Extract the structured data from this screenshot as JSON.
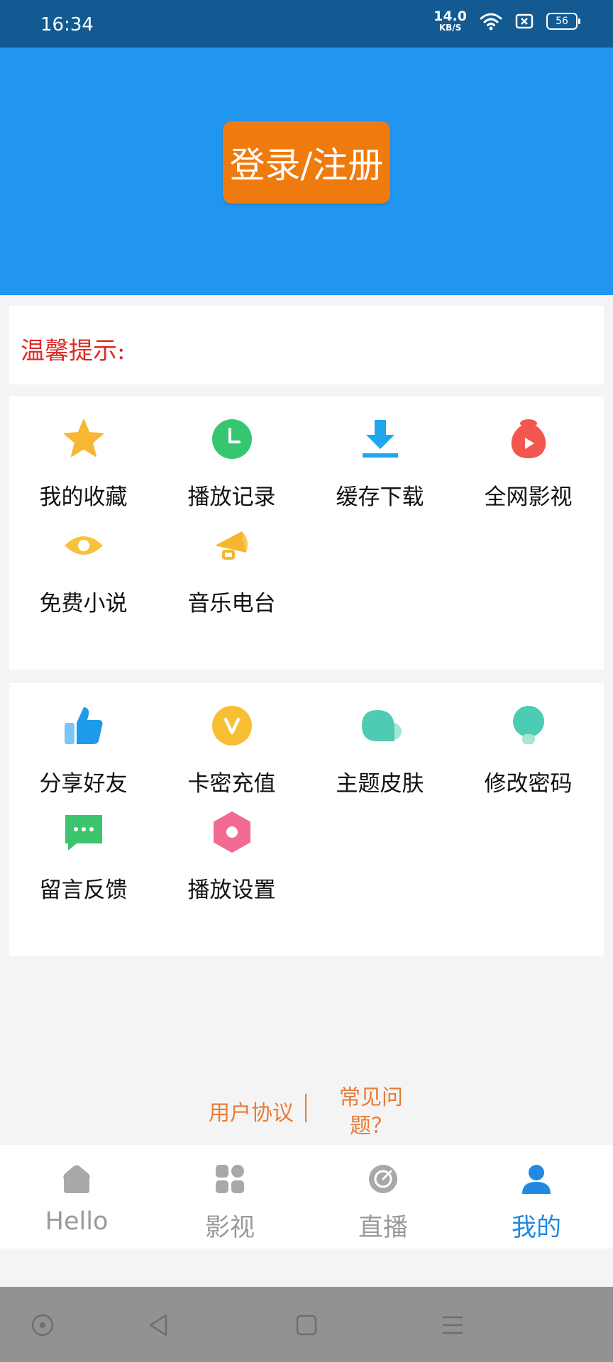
{
  "status_bar": {
    "time": "16:34",
    "net_speed_value": "14.0",
    "net_speed_unit": "KB/S",
    "battery": "56",
    "icons": [
      "wifi-icon",
      "sim-icon",
      "battery-icon"
    ]
  },
  "header": {
    "login_label": "登录/注册",
    "background": "#2196f0",
    "button_color": "#ef7a0d"
  },
  "tip": {
    "label": "温馨提示:"
  },
  "grid1": {
    "items": [
      {
        "label": "我的收藏",
        "icon": "star-icon"
      },
      {
        "label": "播放记录",
        "icon": "clock-icon"
      },
      {
        "label": "缓存下载",
        "icon": "download-icon"
      },
      {
        "label": "全网影视",
        "icon": "video-bag-icon"
      },
      {
        "label": "免费小说",
        "icon": "eye-icon"
      },
      {
        "label": "音乐电台",
        "icon": "megaphone-icon"
      }
    ]
  },
  "grid2": {
    "items": [
      {
        "label": "分享好友",
        "icon": "thumbs-up-icon"
      },
      {
        "label": "卡密充值",
        "icon": "vip-icon"
      },
      {
        "label": "主题皮肤",
        "icon": "cloud-icon"
      },
      {
        "label": "修改密码",
        "icon": "lightbulb-icon"
      },
      {
        "label": "留言反馈",
        "icon": "message-icon"
      },
      {
        "label": "播放设置",
        "icon": "settings-hex-icon"
      }
    ]
  },
  "footer_links": {
    "agreement": "用户协议",
    "faq": "常见问题？"
  },
  "tabbar": {
    "tabs": [
      {
        "label": "Hello",
        "icon": "home-icon"
      },
      {
        "label": "影视",
        "icon": "grid-icon"
      },
      {
        "label": "直播",
        "icon": "radar-icon"
      },
      {
        "label": "我的",
        "icon": "user-icon",
        "active": true
      }
    ],
    "active_color": "#2189e0"
  },
  "system_nav": {
    "caption": "",
    "buttons": [
      "circle-icon",
      "back-icon",
      "home-square-icon",
      "menu-icon"
    ]
  }
}
